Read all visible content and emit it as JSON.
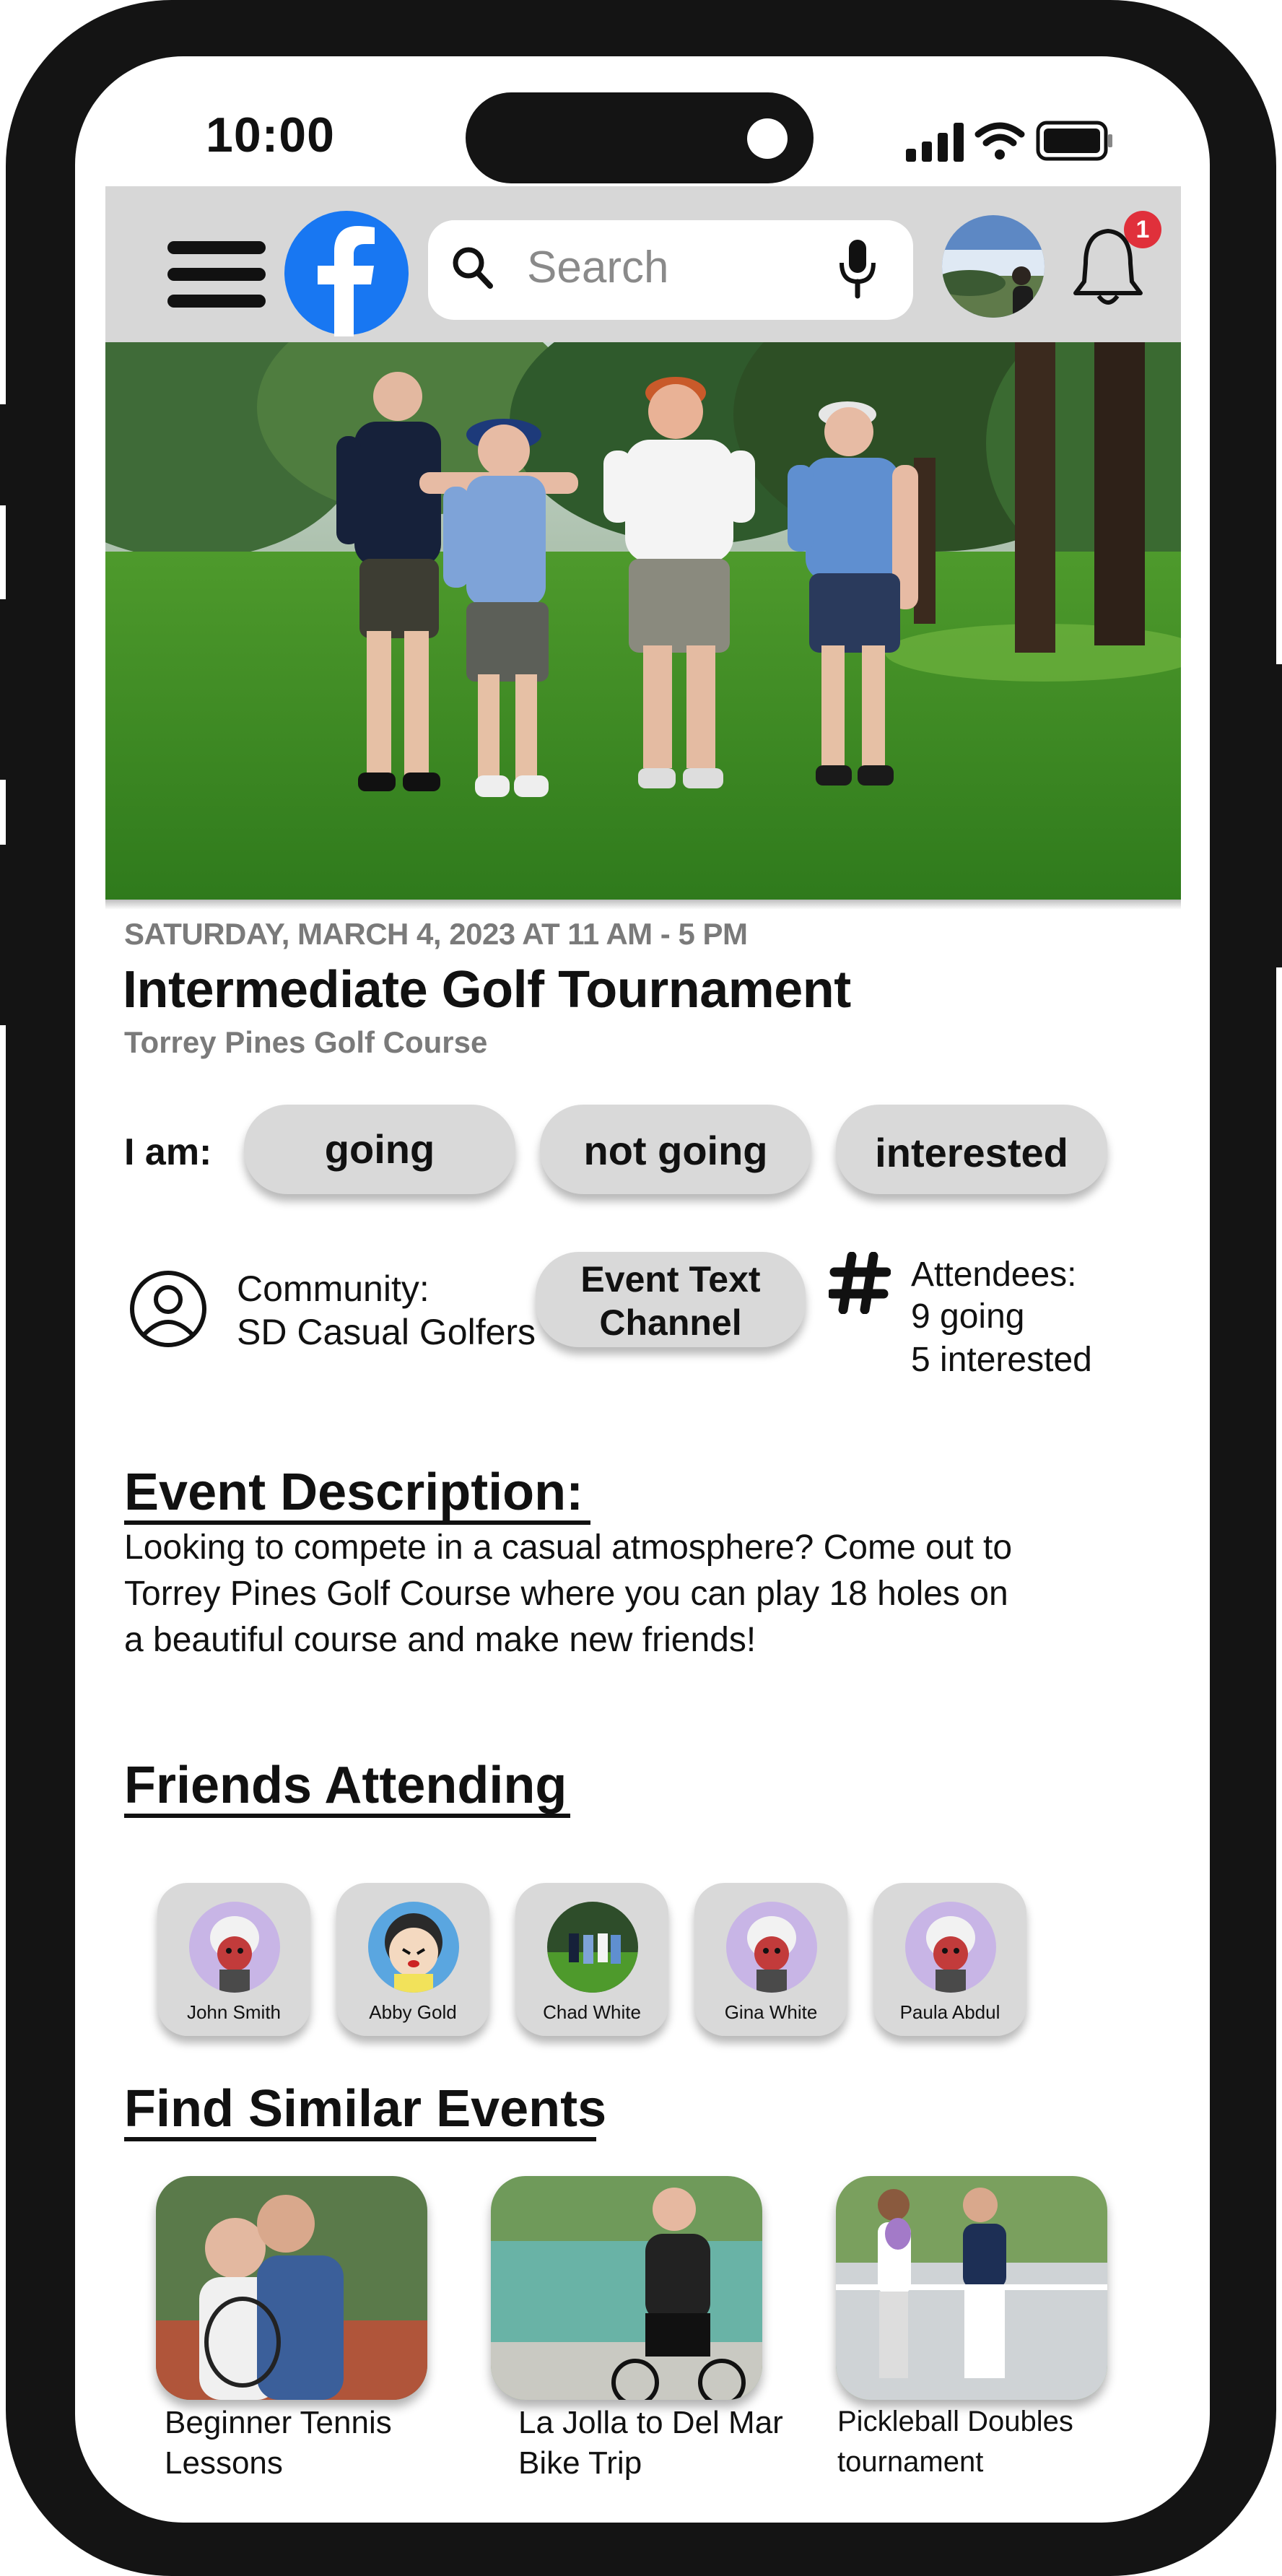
{
  "status_bar": {
    "time": "10:00"
  },
  "header": {
    "search_placeholder": "Search",
    "notification_count": "1",
    "brand_color": "#1877f2",
    "badge_color": "#e0303b"
  },
  "event": {
    "date": "SATURDAY, MARCH 4, 2023 AT 11 AM - 5 PM",
    "title": "Intermediate Golf Tournament",
    "location": "Torrey Pines Golf Course",
    "rsvp_label": "I am:",
    "rsvp_options": [
      "going",
      "not going",
      "interested"
    ],
    "community_label": "Community:",
    "community_name": "SD Casual Golfers",
    "channel_line1": "Event Text",
    "channel_line2": "Channel",
    "attendees_label": "Attendees:",
    "attendees_going": "9 going",
    "attendees_interested": "5 interested"
  },
  "description": {
    "heading": "Event Description:",
    "line1": "Looking to compete in a casual atmosphere? Come out to",
    "line2": "Torrey Pines Golf Course where you can play 18 holes on",
    "line3": "a beautiful course and make new friends!"
  },
  "friends": {
    "heading": "Friends Attending",
    "items": [
      {
        "name": "John Smith"
      },
      {
        "name": "Abby Gold"
      },
      {
        "name": "Chad White"
      },
      {
        "name": "Gina White"
      },
      {
        "name": "Paula Abdul"
      }
    ]
  },
  "similar": {
    "heading": "Find Similar Events",
    "items": [
      {
        "line1": "Beginner Tennis",
        "line2": "Lessons"
      },
      {
        "line1": "La Jolla to Del Mar",
        "line2": "Bike Trip"
      },
      {
        "line1": "Pickleball Doubles",
        "line2": "tournament"
      }
    ]
  }
}
